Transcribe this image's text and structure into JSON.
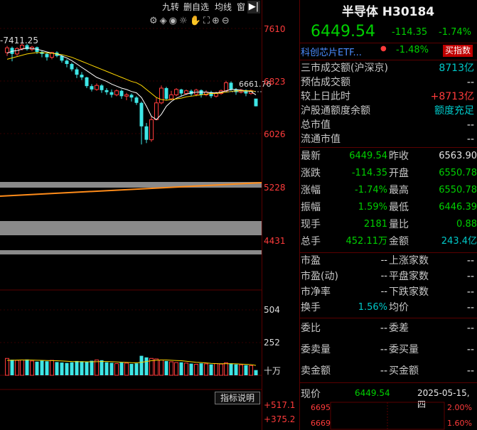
{
  "toolbar": {
    "tabs": [
      "九转",
      "删自选",
      "均线",
      "窗"
    ],
    "icons": [
      "settings-icon",
      "layers-icon",
      "eye-icon",
      "bulb-icon",
      "hand-icon",
      "fullscreen-icon",
      "zoom-in-icon",
      "zoom-out-icon",
      "page-forward-icon"
    ]
  },
  "price_axis": {
    "labels": [
      "7610",
      "6823",
      "6026",
      "5228",
      "4431"
    ],
    "vol_labels": [
      "504",
      "252",
      "十万"
    ],
    "ind_labels": [
      "+517.1",
      "+375.2"
    ]
  },
  "chart_overlay": {
    "high_label": "-7411.25",
    "last_price_tag": "6661.76",
    "indicator_button": "指标说明"
  },
  "chart_data": {
    "type": "candlestick",
    "candles": [
      {
        "o": 7250,
        "c": 7320,
        "h": 7350,
        "l": 7200
      },
      {
        "o": 7320,
        "c": 7230,
        "h": 7340,
        "l": 7120
      },
      {
        "o": 7230,
        "c": 7310,
        "h": 7330,
        "l": 7200
      },
      {
        "o": 7310,
        "c": 7360,
        "h": 7411.25,
        "l": 7280
      },
      {
        "o": 7360,
        "c": 7300,
        "h": 7380,
        "l": 7280
      },
      {
        "o": 7300,
        "c": 7330,
        "h": 7350,
        "l": 7270
      },
      {
        "o": 7330,
        "c": 7260,
        "h": 7340,
        "l": 7230
      },
      {
        "o": 7260,
        "c": 7230,
        "h": 7280,
        "l": 7180
      },
      {
        "o": 7230,
        "c": 7180,
        "h": 7250,
        "l": 7130
      },
      {
        "o": 7180,
        "c": 7250,
        "h": 7260,
        "l": 7150
      },
      {
        "o": 7250,
        "c": 7200,
        "h": 7270,
        "l": 7180
      },
      {
        "o": 7200,
        "c": 7130,
        "h": 7220,
        "l": 7100
      },
      {
        "o": 7130,
        "c": 7080,
        "h": 7150,
        "l": 7030
      },
      {
        "o": 7080,
        "c": 7000,
        "h": 7100,
        "l": 6970
      },
      {
        "o": 7000,
        "c": 6920,
        "h": 7030,
        "l": 6870
      },
      {
        "o": 6920,
        "c": 6880,
        "h": 6960,
        "l": 6840
      },
      {
        "o": 6880,
        "c": 6750,
        "h": 6890,
        "l": 6720
      },
      {
        "o": 6750,
        "c": 6700,
        "h": 6780,
        "l": 6670
      },
      {
        "o": 6700,
        "c": 6760,
        "h": 6790,
        "l": 6680
      },
      {
        "o": 6760,
        "c": 6690,
        "h": 6780,
        "l": 6650
      },
      {
        "o": 6690,
        "c": 6660,
        "h": 6720,
        "l": 6620
      },
      {
        "o": 6660,
        "c": 6620,
        "h": 6700,
        "l": 6580
      },
      {
        "o": 6620,
        "c": 6680,
        "h": 6700,
        "l": 6600
      },
      {
        "o": 6680,
        "c": 6600,
        "h": 6700,
        "l": 6560
      },
      {
        "o": 6600,
        "c": 6620,
        "h": 6650,
        "l": 6540
      },
      {
        "o": 6620,
        "c": 6580,
        "h": 6640,
        "l": 6520
      },
      {
        "o": 6580,
        "c": 6500,
        "h": 6600,
        "l": 6470
      },
      {
        "o": 6500,
        "c": 6150,
        "h": 6520,
        "l": 5880
      },
      {
        "o": 6150,
        "c": 5950,
        "h": 6200,
        "l": 5900
      },
      {
        "o": 5950,
        "c": 6250,
        "h": 6300,
        "l": 5920
      },
      {
        "o": 6250,
        "c": 6500,
        "h": 6580,
        "l": 6240
      },
      {
        "o": 6500,
        "c": 6720,
        "h": 6760,
        "l": 6480
      },
      {
        "o": 6720,
        "c": 6560,
        "h": 6740,
        "l": 6540
      },
      {
        "o": 6560,
        "c": 6620,
        "h": 6680,
        "l": 6540
      },
      {
        "o": 6620,
        "c": 6700,
        "h": 6720,
        "l": 6600
      },
      {
        "o": 6700,
        "c": 6640,
        "h": 6710,
        "l": 6600
      },
      {
        "o": 6640,
        "c": 6680,
        "h": 6700,
        "l": 6620
      },
      {
        "o": 6680,
        "c": 6630,
        "h": 6700,
        "l": 6600
      },
      {
        "o": 6630,
        "c": 6690,
        "h": 6710,
        "l": 6600
      },
      {
        "o": 6690,
        "c": 6620,
        "h": 6700,
        "l": 6580
      },
      {
        "o": 6620,
        "c": 6660,
        "h": 6690,
        "l": 6600
      },
      {
        "o": 6660,
        "c": 6600,
        "h": 6680,
        "l": 6570
      },
      {
        "o": 6600,
        "c": 6640,
        "h": 6670,
        "l": 6580
      },
      {
        "o": 6640,
        "c": 6680,
        "h": 6700,
        "l": 6620
      },
      {
        "o": 6680,
        "c": 6800,
        "h": 6830,
        "l": 6660
      },
      {
        "o": 6800,
        "c": 6700,
        "h": 6820,
        "l": 6680
      },
      {
        "o": 6700,
        "c": 6660,
        "h": 6720,
        "l": 6620
      },
      {
        "o": 6660,
        "c": 6690,
        "h": 6710,
        "l": 6640
      },
      {
        "o": 6690,
        "c": 6640,
        "h": 6700,
        "l": 6600
      },
      {
        "o": 6640,
        "c": 6680,
        "h": 6700,
        "l": 6620
      },
      {
        "o": 6563.9,
        "c": 6449.54,
        "h": 6550.78,
        "l": 6446.39
      }
    ],
    "ma_short": [
      7240,
      7270,
      7280,
      7300,
      7320,
      7310,
      7300,
      7280,
      7260,
      7240,
      7230,
      7200,
      7170,
      7130,
      7080,
      7030,
      6980,
      6930,
      6880,
      6850,
      6820,
      6780,
      6750,
      6720,
      6700,
      6670,
      6650,
      6580,
      6450,
      6300,
      6250,
      6330,
      6450,
      6520,
      6570,
      6600,
      6630,
      6650,
      6660,
      6660,
      6660,
      6650,
      6650,
      6660,
      6680,
      6700,
      6700,
      6690,
      6680,
      6670,
      6620
    ],
    "ma_long": [
      7150,
      7170,
      7190,
      7210,
      7230,
      7240,
      7250,
      7250,
      7245,
      7240,
      7230,
      7220,
      7200,
      7180,
      7150,
      7120,
      7090,
      7060,
      7030,
      7000,
      6970,
      6940,
      6910,
      6880,
      6850,
      6820,
      6800,
      6760,
      6700,
      6640,
      6580,
      6550,
      6540,
      6550,
      6560,
      6570,
      6590,
      6600,
      6610,
      6620,
      6630,
      6640,
      6640,
      6650,
      6660,
      6670,
      6680,
      6680,
      6680,
      6680,
      6670
    ],
    "volume": [
      130,
      120,
      115,
      118,
      122,
      110,
      105,
      112,
      108,
      115,
      102,
      98,
      95,
      100,
      110,
      108,
      104,
      112,
      118,
      116,
      100,
      96,
      90,
      98,
      94,
      88,
      92,
      150,
      138,
      130,
      126,
      118,
      110,
      104,
      98,
      100,
      94,
      90,
      85,
      92,
      88,
      84,
      90,
      86,
      96,
      92,
      84,
      80,
      78,
      74,
      40
    ],
    "vol_ma": [
      115,
      116,
      117,
      118,
      118,
      117,
      116,
      115,
      114,
      113,
      112,
      110,
      108,
      106,
      105,
      105,
      104,
      104,
      105,
      106,
      106,
      105,
      103,
      101,
      99,
      97,
      96,
      100,
      106,
      112,
      116,
      118,
      118,
      116,
      114,
      112,
      108,
      104,
      100,
      98,
      95,
      92,
      90,
      89,
      89,
      89,
      88,
      86,
      84,
      82,
      76
    ],
    "y_range": [
      4431,
      7610
    ],
    "vol_range": [
      0,
      504
    ]
  },
  "header": {
    "title": "半导体 H30184",
    "price": "6449.54",
    "change": "-114.35",
    "change_pct": "-1.74%"
  },
  "etf": {
    "name": "科创芯片ETF...",
    "change": "-1.48%",
    "button": "买指数"
  },
  "market": [
    {
      "label": "三市成交额(沪深京)",
      "value": "8713亿",
      "cls": "cy"
    },
    {
      "label": "预估成交额",
      "value": "--",
      "cls": "wht"
    },
    {
      "label": "较上日此时",
      "value": "+8713亿",
      "cls": "up"
    },
    {
      "label": "沪股通额度余额",
      "value": "额度充足",
      "cls": "cy"
    },
    {
      "label": "总市值",
      "value": "--",
      "cls": "wht"
    },
    {
      "label": "流通市值",
      "value": "--",
      "cls": "wht"
    }
  ],
  "quote": [
    {
      "l1": "最新",
      "v1": "6449.54",
      "c1": "dn",
      "l2": "昨收",
      "v2": "6563.90",
      "c2": "wht"
    },
    {
      "l1": "涨跌",
      "v1": "-114.35",
      "c1": "dn",
      "l2": "开盘",
      "v2": "6550.78",
      "c2": "dn"
    },
    {
      "l1": "涨幅",
      "v1": "-1.74%",
      "c1": "dn",
      "l2": "最高",
      "v2": "6550.78",
      "c2": "dn"
    },
    {
      "l1": "振幅",
      "v1": "1.59%",
      "c1": "dn",
      "l2": "最低",
      "v2": "6446.39",
      "c2": "dn"
    },
    {
      "l1": "现手",
      "v1": "2181",
      "c1": "dn",
      "l2": "量比",
      "v2": "0.88",
      "c2": "dn"
    },
    {
      "l1": "总手",
      "v1": "452.11万",
      "c1": "dn",
      "l2": "金额",
      "v2": "243.4亿",
      "c2": "cy"
    }
  ],
  "valuation": [
    {
      "l1": "市盈",
      "v1": "--",
      "l2": "上涨家数",
      "v2": "--"
    },
    {
      "l1": "市盈(动)",
      "v1": "--",
      "l2": "平盘家数",
      "v2": "--"
    },
    {
      "l1": "市净率",
      "v1": "--",
      "l2": "下跌家数",
      "v2": "--"
    },
    {
      "l1": "换手",
      "v1": "1.56%",
      "l2": "均价",
      "v2": "--"
    }
  ],
  "orders": [
    {
      "l1": "委比",
      "v1": "--",
      "l2": "委差",
      "v2": "--"
    },
    {
      "l1": "委卖量",
      "v1": "--",
      "l2": "委买量",
      "v2": "--"
    },
    {
      "l1": "卖金额",
      "v1": "--",
      "l2": "买金额",
      "v2": "--"
    }
  ],
  "intraday": {
    "label": "现价",
    "price": "6449.54",
    "date": "2025-05-15,四",
    "rows": [
      {
        "left": "6695",
        "right": "2.00%"
      },
      {
        "left": "6669",
        "right": "1.60%"
      }
    ]
  },
  "colors": {
    "up": "#ff3b3b",
    "down": "#00d000",
    "accent": "#00c8c8",
    "axis": "#ff3b3b",
    "ma_short": "#ffffff",
    "ma_long": "#ffd700",
    "volume": "#3ee6e6"
  }
}
